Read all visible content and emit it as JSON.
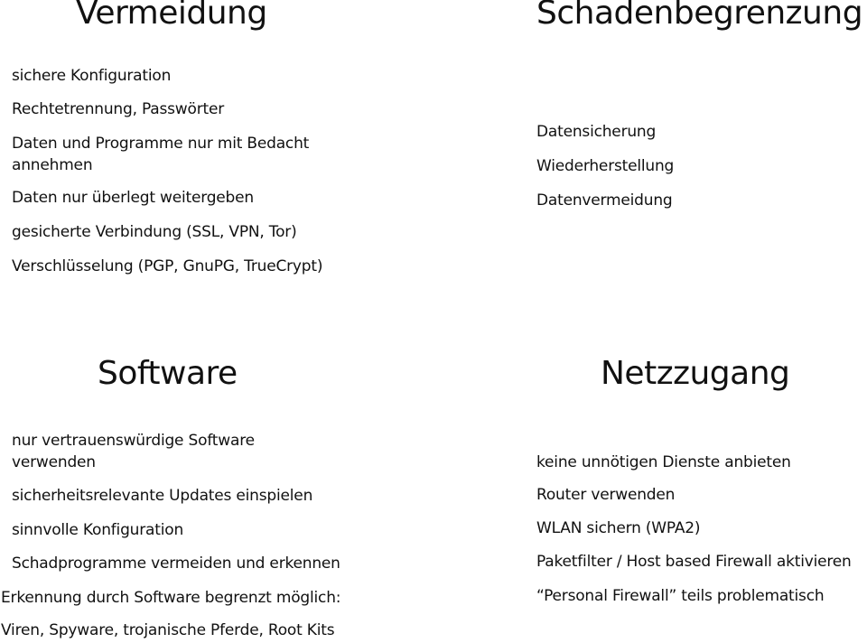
{
  "sections": {
    "vermeidung": {
      "title": "Vermeidung",
      "items": [
        "sichere Konfiguration",
        "Rechtetrennung, Passwörter",
        "Daten und Programme nur mit Bedacht annehmen",
        "Daten nur überlegt weitergeben",
        "gesicherte Verbindung (SSL, VPN, Tor)",
        "Verschlüsselung (PGP, GnuPG, TrueCrypt)"
      ]
    },
    "schadenbegrenzung": {
      "title": "Schadenbegrenzung",
      "items": [
        "Datensicherung",
        "Wiederherstellung",
        "Datenvermeidung"
      ]
    },
    "software": {
      "title": "Software",
      "items": [
        "nur vertrauenswürdige Software verwenden",
        "sicherheitsrelevante Updates einspielen",
        "sinnvolle Konfiguration",
        "Schadprogramme vermeiden und erkennen",
        "Erkennung durch Software begrenzt möglich:",
        "Viren, Spyware, trojanische Pferde, Root Kits"
      ]
    },
    "netzzugang": {
      "title": "Netzzugang",
      "items": [
        "keine unnötigen Dienste anbieten",
        "Router verwenden",
        "WLAN sichern (WPA2)",
        "Paketfilter / Host based Firewall aktivieren",
        "“Personal Firewall” teils problematisch"
      ]
    }
  }
}
